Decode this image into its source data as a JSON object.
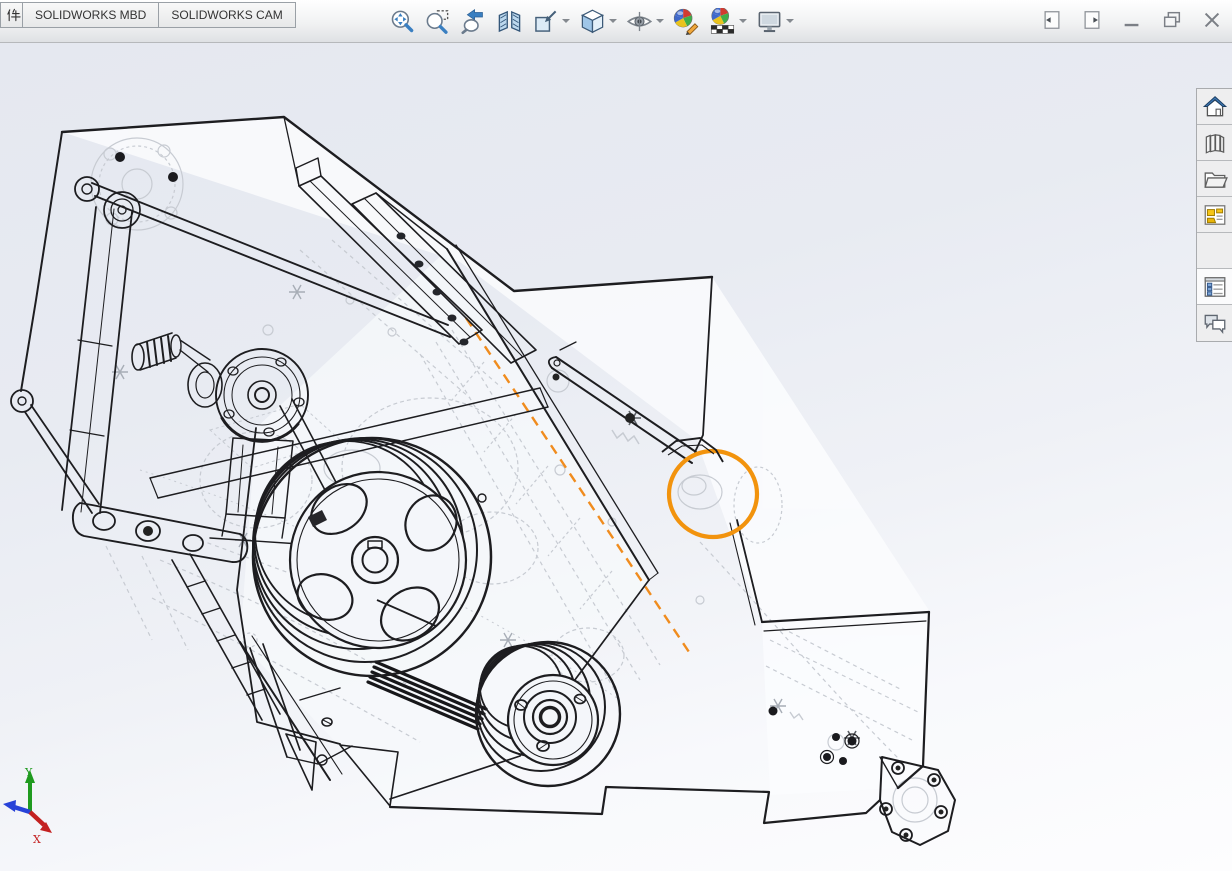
{
  "window": {
    "tab_bar": {
      "partial_tab": "件",
      "tabs": [
        "SOLIDWORKS MBD",
        "SOLIDWORKS CAM"
      ]
    },
    "controls": [
      {
        "name": "collapse-left-pane",
        "icon": "pane-left"
      },
      {
        "name": "collapse-right-pane",
        "icon": "pane-right"
      },
      {
        "name": "minimize",
        "icon": "minimize"
      },
      {
        "name": "restore",
        "icon": "restore"
      },
      {
        "name": "close",
        "icon": "close"
      }
    ]
  },
  "heads_up_toolbar": {
    "items": [
      {
        "name": "zoom-to-fit",
        "icon": "zoom-fit",
        "dropdown": false
      },
      {
        "name": "zoom-to-area",
        "icon": "zoom-area",
        "dropdown": false
      },
      {
        "name": "previous-view",
        "icon": "previous-view",
        "dropdown": false
      },
      {
        "name": "section-view",
        "icon": "section-view",
        "dropdown": false
      },
      {
        "name": "view-orientation",
        "icon": "view-orientation",
        "dropdown": true
      },
      {
        "name": "display-style",
        "icon": "display-style",
        "dropdown": true
      },
      {
        "name": "hide-show-items",
        "icon": "eye",
        "dropdown": true
      },
      {
        "name": "edit-appearance",
        "icon": "ball-pencil",
        "dropdown": false
      },
      {
        "name": "apply-scene",
        "icon": "ball-checker",
        "dropdown": true
      },
      {
        "name": "view-settings",
        "icon": "monitor",
        "dropdown": true
      }
    ]
  },
  "task_pane": {
    "items": [
      {
        "name": "solidworks-resources",
        "icon": "home",
        "active": false
      },
      {
        "name": "design-library",
        "icon": "design-library",
        "active": false
      },
      {
        "name": "file-explorer",
        "icon": "file-explorer",
        "active": false
      },
      {
        "name": "view-palette",
        "icon": "view-palette",
        "active": false
      },
      {
        "name": "appearances-scenes",
        "icon": "appearances",
        "active": false
      },
      {
        "name": "custom-properties",
        "icon": "custom-properties",
        "active": true
      },
      {
        "name": "solidworks-forum",
        "icon": "forum",
        "active": false
      }
    ]
  },
  "viewport": {
    "triad": {
      "x_label": "X",
      "y_label": "Y",
      "x_color": "#c32121",
      "y_color": "#1f9a1f",
      "z_color": "#2742d8"
    },
    "selection": {
      "highlight_color": "#F2930D"
    },
    "centerline_color": "#F08C1E",
    "ghost_line_color": "#c7cbd2",
    "edge_color": "#1d1d20"
  }
}
